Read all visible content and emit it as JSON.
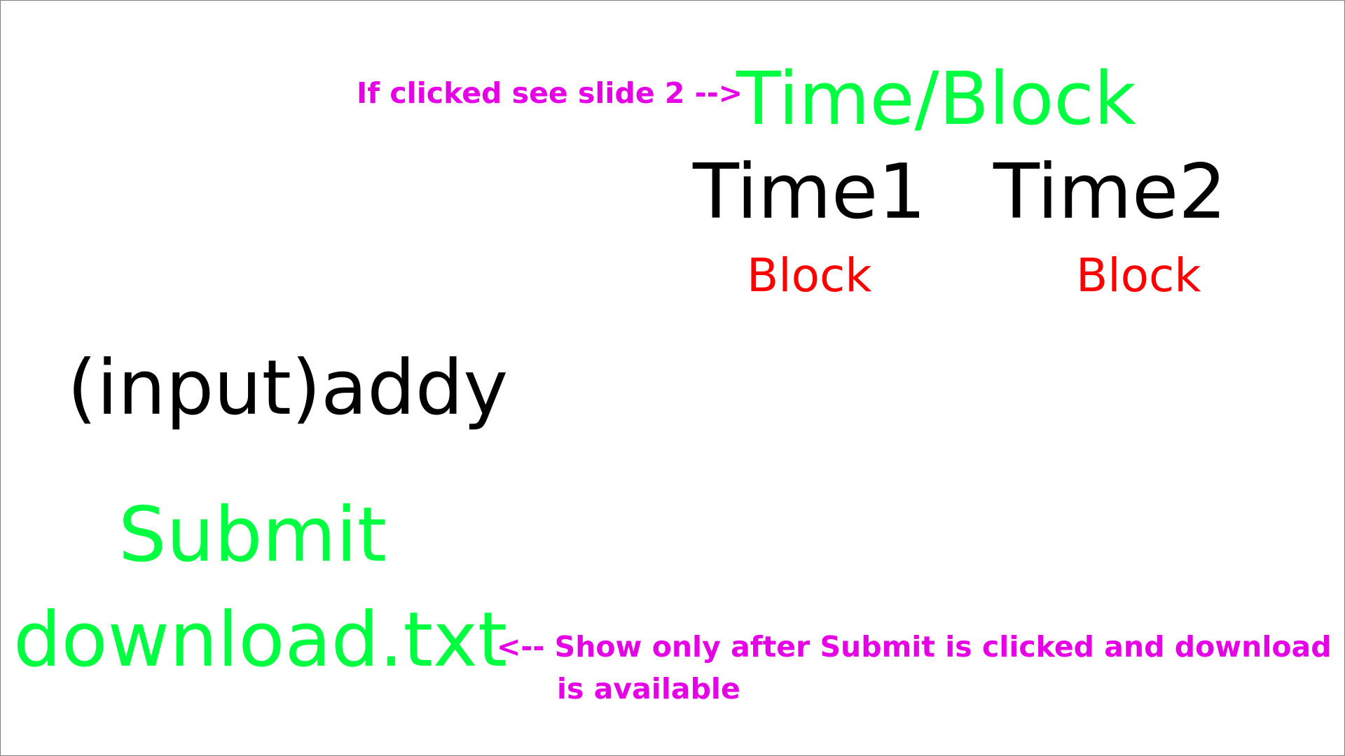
{
  "colors": {
    "primary_green": "#00ff40",
    "annotation_magenta": "#e600e6",
    "block_red": "#ff0000",
    "text_black": "#000000"
  },
  "annotations": {
    "top": "If clicked see slide 2 -->",
    "bottom_line1": "<-- Show only after Submit is clicked and download",
    "bottom_line2": "is available"
  },
  "header": {
    "time_block_label": "Time/Block"
  },
  "columns": [
    {
      "time_label": "Time1",
      "block_label": "Block"
    },
    {
      "time_label": "Time2",
      "block_label": "Block"
    }
  ],
  "form": {
    "addy_label": "(input)addy",
    "submit_label": "Submit",
    "download_label": "download.txt"
  }
}
